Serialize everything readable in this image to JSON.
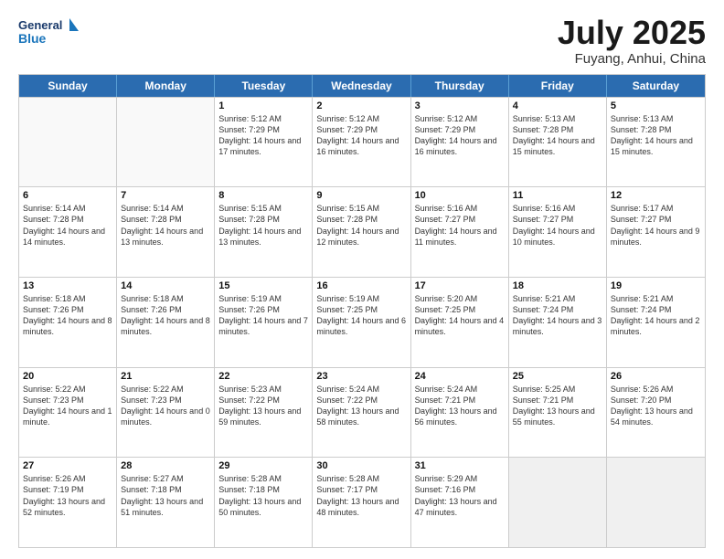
{
  "logo": {
    "line1": "General",
    "line2": "Blue"
  },
  "title": "July 2025",
  "subtitle": "Fuyang, Anhui, China",
  "days": [
    "Sunday",
    "Monday",
    "Tuesday",
    "Wednesday",
    "Thursday",
    "Friday",
    "Saturday"
  ],
  "rows": [
    [
      {
        "day": "",
        "text": "",
        "empty": true
      },
      {
        "day": "",
        "text": "",
        "empty": true
      },
      {
        "day": "1",
        "text": "Sunrise: 5:12 AM\nSunset: 7:29 PM\nDaylight: 14 hours and 17 minutes."
      },
      {
        "day": "2",
        "text": "Sunrise: 5:12 AM\nSunset: 7:29 PM\nDaylight: 14 hours and 16 minutes."
      },
      {
        "day": "3",
        "text": "Sunrise: 5:12 AM\nSunset: 7:29 PM\nDaylight: 14 hours and 16 minutes."
      },
      {
        "day": "4",
        "text": "Sunrise: 5:13 AM\nSunset: 7:28 PM\nDaylight: 14 hours and 15 minutes."
      },
      {
        "day": "5",
        "text": "Sunrise: 5:13 AM\nSunset: 7:28 PM\nDaylight: 14 hours and 15 minutes."
      }
    ],
    [
      {
        "day": "6",
        "text": "Sunrise: 5:14 AM\nSunset: 7:28 PM\nDaylight: 14 hours and 14 minutes."
      },
      {
        "day": "7",
        "text": "Sunrise: 5:14 AM\nSunset: 7:28 PM\nDaylight: 14 hours and 13 minutes."
      },
      {
        "day": "8",
        "text": "Sunrise: 5:15 AM\nSunset: 7:28 PM\nDaylight: 14 hours and 13 minutes."
      },
      {
        "day": "9",
        "text": "Sunrise: 5:15 AM\nSunset: 7:28 PM\nDaylight: 14 hours and 12 minutes."
      },
      {
        "day": "10",
        "text": "Sunrise: 5:16 AM\nSunset: 7:27 PM\nDaylight: 14 hours and 11 minutes."
      },
      {
        "day": "11",
        "text": "Sunrise: 5:16 AM\nSunset: 7:27 PM\nDaylight: 14 hours and 10 minutes."
      },
      {
        "day": "12",
        "text": "Sunrise: 5:17 AM\nSunset: 7:27 PM\nDaylight: 14 hours and 9 minutes."
      }
    ],
    [
      {
        "day": "13",
        "text": "Sunrise: 5:18 AM\nSunset: 7:26 PM\nDaylight: 14 hours and 8 minutes."
      },
      {
        "day": "14",
        "text": "Sunrise: 5:18 AM\nSunset: 7:26 PM\nDaylight: 14 hours and 8 minutes."
      },
      {
        "day": "15",
        "text": "Sunrise: 5:19 AM\nSunset: 7:26 PM\nDaylight: 14 hours and 7 minutes."
      },
      {
        "day": "16",
        "text": "Sunrise: 5:19 AM\nSunset: 7:25 PM\nDaylight: 14 hours and 6 minutes."
      },
      {
        "day": "17",
        "text": "Sunrise: 5:20 AM\nSunset: 7:25 PM\nDaylight: 14 hours and 4 minutes."
      },
      {
        "day": "18",
        "text": "Sunrise: 5:21 AM\nSunset: 7:24 PM\nDaylight: 14 hours and 3 minutes."
      },
      {
        "day": "19",
        "text": "Sunrise: 5:21 AM\nSunset: 7:24 PM\nDaylight: 14 hours and 2 minutes."
      }
    ],
    [
      {
        "day": "20",
        "text": "Sunrise: 5:22 AM\nSunset: 7:23 PM\nDaylight: 14 hours and 1 minute."
      },
      {
        "day": "21",
        "text": "Sunrise: 5:22 AM\nSunset: 7:23 PM\nDaylight: 14 hours and 0 minutes."
      },
      {
        "day": "22",
        "text": "Sunrise: 5:23 AM\nSunset: 7:22 PM\nDaylight: 13 hours and 59 minutes."
      },
      {
        "day": "23",
        "text": "Sunrise: 5:24 AM\nSunset: 7:22 PM\nDaylight: 13 hours and 58 minutes."
      },
      {
        "day": "24",
        "text": "Sunrise: 5:24 AM\nSunset: 7:21 PM\nDaylight: 13 hours and 56 minutes."
      },
      {
        "day": "25",
        "text": "Sunrise: 5:25 AM\nSunset: 7:21 PM\nDaylight: 13 hours and 55 minutes."
      },
      {
        "day": "26",
        "text": "Sunrise: 5:26 AM\nSunset: 7:20 PM\nDaylight: 13 hours and 54 minutes."
      }
    ],
    [
      {
        "day": "27",
        "text": "Sunrise: 5:26 AM\nSunset: 7:19 PM\nDaylight: 13 hours and 52 minutes."
      },
      {
        "day": "28",
        "text": "Sunrise: 5:27 AM\nSunset: 7:18 PM\nDaylight: 13 hours and 51 minutes."
      },
      {
        "day": "29",
        "text": "Sunrise: 5:28 AM\nSunset: 7:18 PM\nDaylight: 13 hours and 50 minutes."
      },
      {
        "day": "30",
        "text": "Sunrise: 5:28 AM\nSunset: 7:17 PM\nDaylight: 13 hours and 48 minutes."
      },
      {
        "day": "31",
        "text": "Sunrise: 5:29 AM\nSunset: 7:16 PM\nDaylight: 13 hours and 47 minutes."
      },
      {
        "day": "",
        "text": "",
        "empty": true
      },
      {
        "day": "",
        "text": "",
        "empty": true
      }
    ]
  ]
}
